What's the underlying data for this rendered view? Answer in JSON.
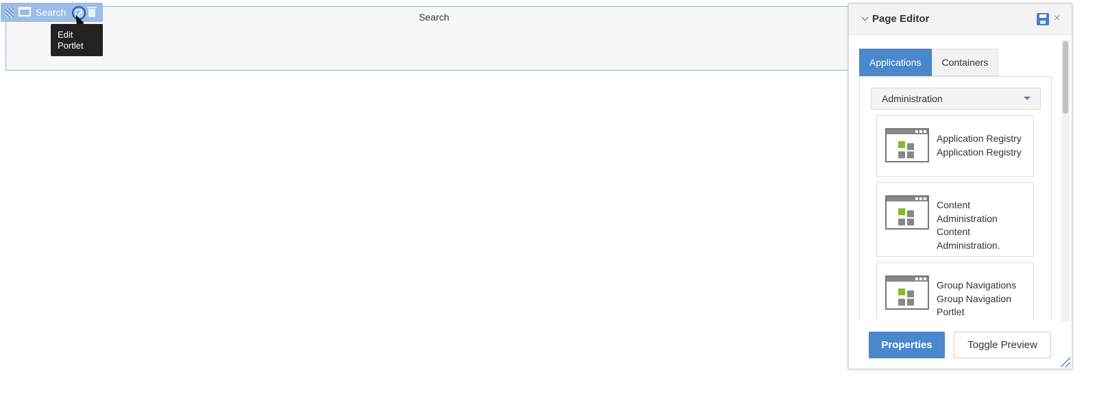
{
  "portlet": {
    "title": "Search",
    "toolbar_title": "Search",
    "tooltip": "Edit Portlet"
  },
  "page_editor": {
    "title": "Page Editor",
    "tabs": [
      {
        "label": "Applications",
        "active": true
      },
      {
        "label": "Containers",
        "active": false
      }
    ],
    "category": "Administration",
    "applications": [
      {
        "label": "Application Registry Application Registry"
      },
      {
        "label": "Content Administration Content Administration."
      },
      {
        "label": "Group Navigations Group Navigation Portlet"
      }
    ],
    "buttons": {
      "properties": "Properties",
      "toggle_preview": "Toggle Preview"
    }
  },
  "colors": {
    "accent": "#4a88cb",
    "toolbar": "#9bbde6",
    "tooltip_bg": "#222222"
  }
}
